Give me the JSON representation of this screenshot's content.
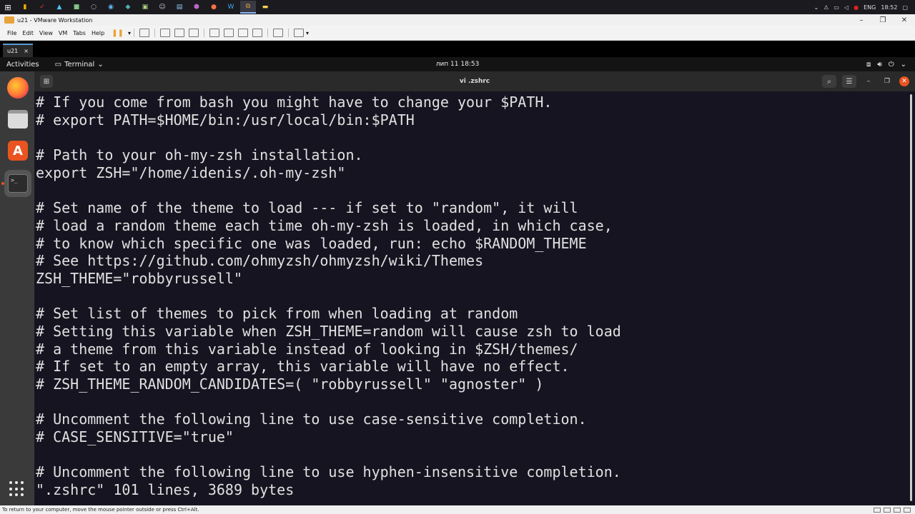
{
  "win_taskbar": {
    "start_icon": "windows-logo-icon",
    "tray": {
      "lang": "ENG",
      "time": "18:52"
    }
  },
  "vmware": {
    "window_title": "u21 - VMware Workstation",
    "menu": [
      "File",
      "Edit",
      "View",
      "VM",
      "Tabs",
      "Help"
    ],
    "tab_label": "u21",
    "tab_close": "×",
    "status_text": "To return to your computer, move the mouse pointer outside or press Ctrl+Alt."
  },
  "gnome": {
    "activities": "Activities",
    "app_menu": "Terminal",
    "clock": "лип 11  18:53"
  },
  "terminal": {
    "title": "vi .zshrc",
    "lines": [
      "# If you come from bash you might have to change your $PATH.",
      "# export PATH=$HOME/bin:/usr/local/bin:$PATH",
      "",
      "# Path to your oh-my-zsh installation.",
      "export ZSH=\"/home/idenis/.oh-my-zsh\"",
      "",
      "# Set name of the theme to load --- if set to \"random\", it will",
      "# load a random theme each time oh-my-zsh is loaded, in which case,",
      "# to know which specific one was loaded, run: echo $RANDOM_THEME",
      "# See https://github.com/ohmyzsh/ohmyzsh/wiki/Themes",
      "ZSH_THEME=\"robbyrussell\"",
      "",
      "# Set list of themes to pick from when loading at random",
      "# Setting this variable when ZSH_THEME=random will cause zsh to load",
      "# a theme from this variable instead of looking in $ZSH/themes/",
      "# If set to an empty array, this variable will have no effect.",
      "# ZSH_THEME_RANDOM_CANDIDATES=( \"robbyrussell\" \"agnoster\" )",
      "",
      "# Uncomment the following line to use case-sensitive completion.",
      "# CASE_SENSITIVE=\"true\"",
      "",
      "# Uncomment the following line to use hyphen-insensitive completion.",
      "\".zshrc\" 101 lines, 3689 bytes"
    ]
  },
  "colors": {
    "terminal_bg": "#171421",
    "ubuntu_orange": "#e95420"
  }
}
